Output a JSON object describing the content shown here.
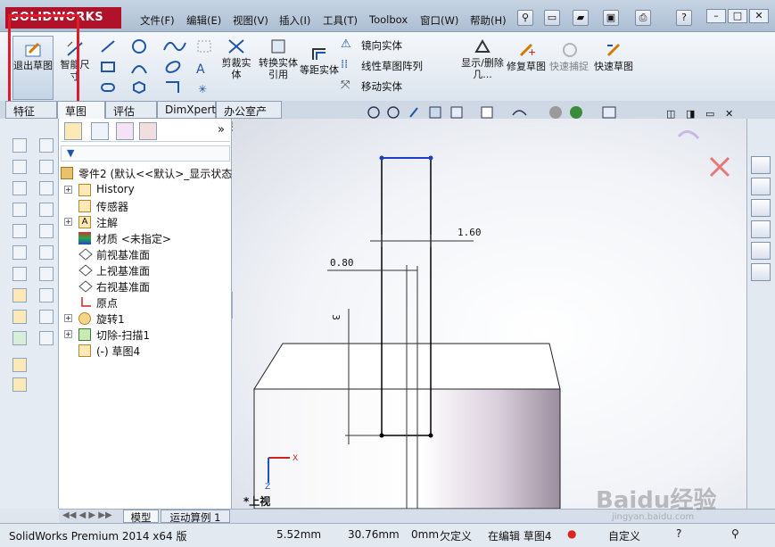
{
  "app": {
    "logo_text": "SOLIDWORKS",
    "menus": [
      "文件(F)",
      "编辑(E)",
      "视图(V)",
      "插入(I)",
      "工具(T)",
      "Toolbox",
      "窗口(W)",
      "帮助(H)"
    ]
  },
  "ribbon": {
    "exit_sketch": "退出草图",
    "smart_dim": "智能尺寸",
    "trim": "剪裁实体",
    "convert": "转换实体引用",
    "offset": "等距实体",
    "mirror": "镜向实体",
    "linear_pattern": "线性草图阵列",
    "move": "移动实体",
    "show_delete": "显示/删除几...",
    "repair": "修复草图",
    "quick_snap": "快速捕捉",
    "rapid_sketch": "快速草图"
  },
  "tabs": [
    "特征",
    "草图",
    "评估",
    "DimXpert",
    "办公室产品"
  ],
  "tree": {
    "part": "零件2 (默认<<默认>_显示状态",
    "items": [
      {
        "label": "History",
        "expandable": true
      },
      {
        "label": "传感器",
        "expandable": false
      },
      {
        "label": "注解",
        "expandable": true
      },
      {
        "label": "材质 <未指定>",
        "expandable": false
      },
      {
        "label": "前视基准面",
        "expandable": false
      },
      {
        "label": "上视基准面",
        "expandable": false
      },
      {
        "label": "右视基准面",
        "expandable": false
      },
      {
        "label": "原点",
        "expandable": false
      },
      {
        "label": "旋转1",
        "expandable": true
      },
      {
        "label": "切除-扫描1",
        "expandable": true
      },
      {
        "label": "(-) 草图4",
        "expandable": false
      }
    ]
  },
  "viewport": {
    "dim1": "1.60",
    "dim2": "0.80",
    "dim3": "3",
    "view_label": "*上视",
    "axis_x": "X",
    "axis_z": "Z"
  },
  "bottom_tabs": [
    "模型",
    "运动算例 1"
  ],
  "status": {
    "product": "SolidWorks Premium 2014 x64 版",
    "x": "5.52mm",
    "y": "30.76mm",
    "z": "0mm",
    "defined": "欠定义",
    "editing": "在编辑 草图4",
    "custom": "自定义"
  },
  "watermark": {
    "brand": "Baidu经验",
    "url": "jingyan.baidu.com"
  },
  "colors": {
    "highlight_box": "#e0192b",
    "accent": "#2156a8"
  }
}
